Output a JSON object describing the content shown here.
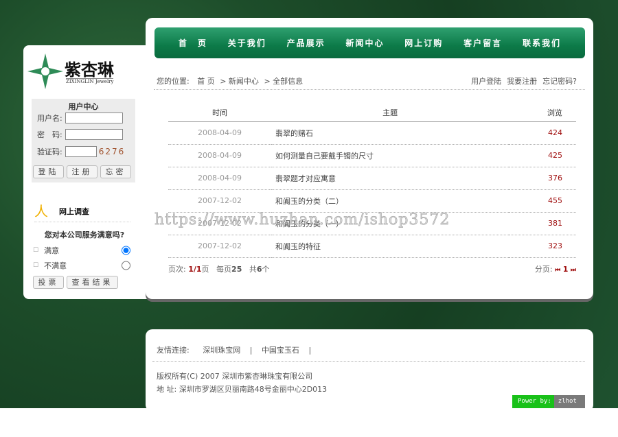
{
  "nav": [
    "首　页",
    "关于我们",
    "产品展示",
    "新闻中心",
    "网上订购",
    "客户留言",
    "联系我们"
  ],
  "logo": {
    "name": "紫杏琳",
    "sub": "ZIXINGLIN  Jewelry"
  },
  "user_center": {
    "title": "用户中心",
    "username_label": "用户名:",
    "password_label": "密　码:",
    "captcha_label": "验证码:",
    "captcha": "6276",
    "login": "登陆",
    "register": "注册",
    "forgot": "忘密"
  },
  "survey": {
    "title": "网上调查",
    "question": "您对本公司服务满意吗?",
    "options": [
      "满意",
      "不满意"
    ],
    "selected": 0,
    "vote": "投票",
    "results": "查看结果"
  },
  "breadcrumb": {
    "label": "您的位置:",
    "items": [
      "首 页",
      "> 新闻中心",
      "> 全部信息"
    ],
    "links": [
      "用户登陆",
      "我要注册",
      "忘记密码?"
    ]
  },
  "table": {
    "headers": [
      "时间",
      "主题",
      "浏览"
    ],
    "rows": [
      [
        "2008-04-09",
        "翡翠的赌石",
        "424"
      ],
      [
        "2008-04-09",
        "如何测量自己要戴手镯的尺寸",
        "425"
      ],
      [
        "2008-04-09",
        "翡翠题才对应寓意",
        "376"
      ],
      [
        "2007-12-02",
        "和阗玉的分类（二）",
        "455"
      ],
      [
        "2007-12-02",
        "和阗玉的分类（一）",
        "381"
      ],
      [
        "2007-12-02",
        "和阗玉的特征",
        "323"
      ]
    ]
  },
  "pager": {
    "page_label": "页次:",
    "page": "1/1",
    "page_unit": "页",
    "per_label": "每页",
    "per": "25",
    "total_label": "共",
    "total": "6",
    "total_unit": "个",
    "nav_label": "分页:",
    "first": "⏮",
    "current": "1",
    "last": "⏭"
  },
  "footer": {
    "friend_label": "友情连接:",
    "friends": [
      "深圳珠宝网",
      "|",
      "中国宝玉石",
      "|"
    ],
    "copyright": "版权所有(C) 2007 深圳市紫杏琳珠宝有限公司",
    "address": "地 址: 深圳市罗湖区贝丽南路48号金丽中心2D013",
    "power_by": "Power by:",
    "power_name": "zlhot"
  },
  "watermark": "https://www.huzhan.com/ishop3572",
  "colors": {
    "nav": "#0c7a48",
    "accent": "#a01010"
  }
}
